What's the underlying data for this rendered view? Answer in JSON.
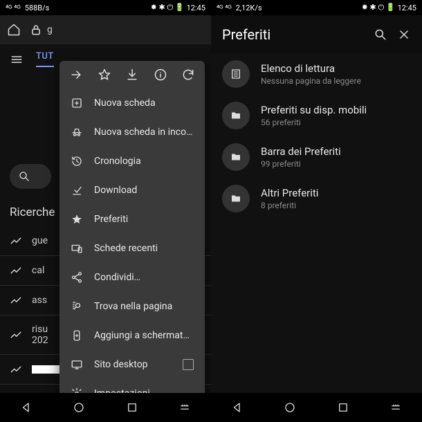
{
  "left": {
    "statusbar": {
      "signal": "⁴ᴳ ⁴ᴳ",
      "speed": "588B/s",
      "time": "12:45"
    },
    "url": "g",
    "tab_active": "TUT",
    "search_placeholder": "",
    "section_title": "Ricerche",
    "trends": [
      "gue",
      "cal",
      "ass",
      "risu\n202"
    ],
    "menu": {
      "items": [
        "Nuova scheda",
        "Nuova scheda in incogn…",
        "Cronologia",
        "Download",
        "Preferiti",
        "Schede recenti",
        "Condividi…",
        "Trova nella pagina",
        "Aggiungi a schermata H…",
        "Sito desktop",
        "Impostazioni"
      ]
    }
  },
  "right": {
    "statusbar": {
      "signal": "⁴ᴳ ⁴ᴳ",
      "speed": "2,12K/s",
      "time": "12:45"
    },
    "title": "Preferiti",
    "folders": [
      {
        "name": "Elenco di lettura",
        "sub": "Nessuna pagina da leggere",
        "icon": "reading"
      },
      {
        "name": "Preferiti su disp. mobili",
        "sub": "56 preferiti",
        "icon": "folder"
      },
      {
        "name": "Barra dei Preferiti",
        "sub": "99 preferiti",
        "icon": "folder"
      },
      {
        "name": "Altri Preferiti",
        "sub": "8 preferiti",
        "icon": "folder"
      }
    ]
  }
}
